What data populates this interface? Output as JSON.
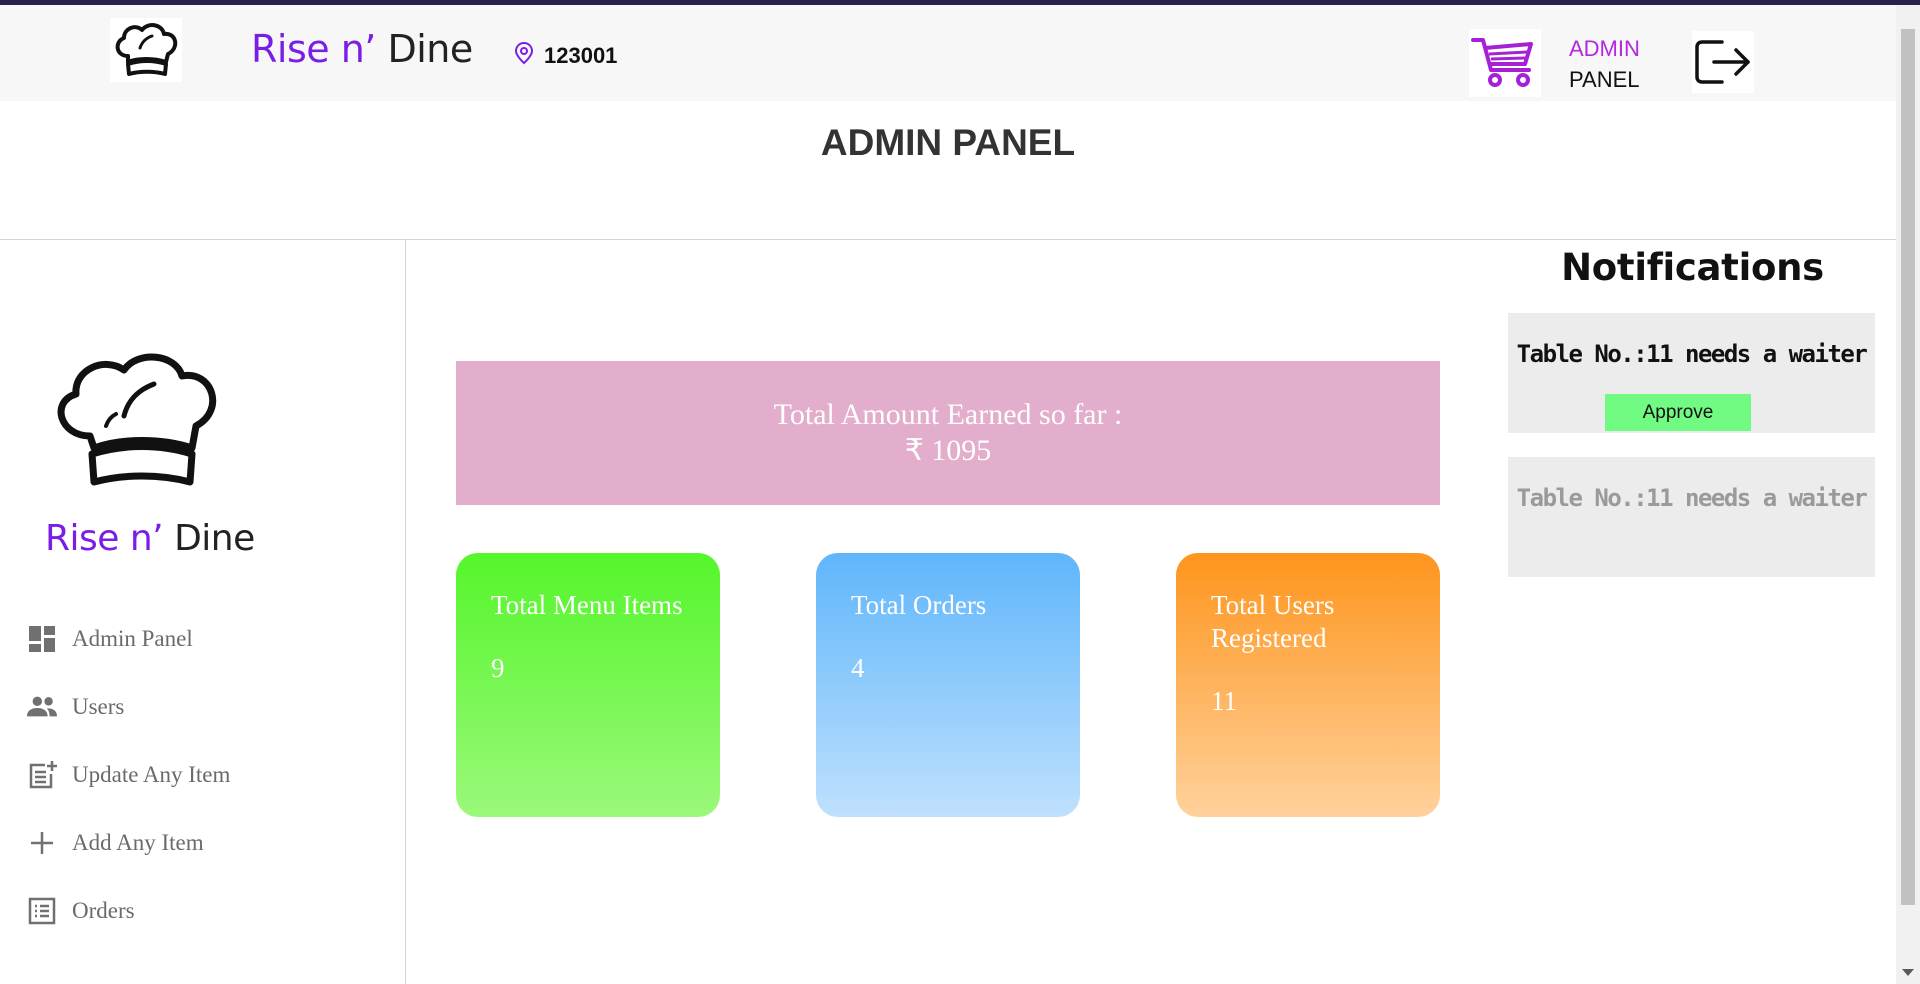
{
  "navbar": {
    "brand_part1": "Rise n’",
    "brand_part2": " Dine",
    "location": "123001",
    "admin_line1": "ADMIN",
    "admin_line2": "PANEL",
    "icons": {
      "logo": "chef-hat-icon",
      "location": "location-pin-icon",
      "cart": "cart-icon",
      "logout": "logout-icon"
    }
  },
  "page": {
    "heading": "ADMIN PANEL"
  },
  "sidebar": {
    "brand_part1": "Rise n’",
    "brand_part2": " Dine",
    "items": [
      {
        "label": "Admin Panel",
        "icon": "dashboard-icon"
      },
      {
        "label": "Users",
        "icon": "users-icon"
      },
      {
        "label": "Update Any Item",
        "icon": "post-add-icon"
      },
      {
        "label": "Add Any Item",
        "icon": "plus-icon"
      },
      {
        "label": "Orders",
        "icon": "list-icon"
      }
    ]
  },
  "stats": {
    "earned_label": "Total Amount Earned so far :",
    "earned_value": "₹ 1095",
    "cards": [
      {
        "label": "Total Menu Items",
        "value": "9",
        "color": "#55f62b"
      },
      {
        "label": "Total Orders",
        "value": "4",
        "color": "#5fb6fb"
      },
      {
        "label": "Total Users Registered",
        "value": "11",
        "color": "#fe951d"
      }
    ]
  },
  "notifications": {
    "title": "Notifications",
    "items": [
      {
        "text": "Table No.:11 needs a waiter",
        "action": "Approve"
      },
      {
        "text": "Table No.:11 needs a waiter"
      }
    ]
  },
  "colors": {
    "brand_purple": "#7a1ee6",
    "admin_accent": "#b428e0",
    "earned_bg": "#e3aecb",
    "approve_bg": "#72fb82"
  }
}
